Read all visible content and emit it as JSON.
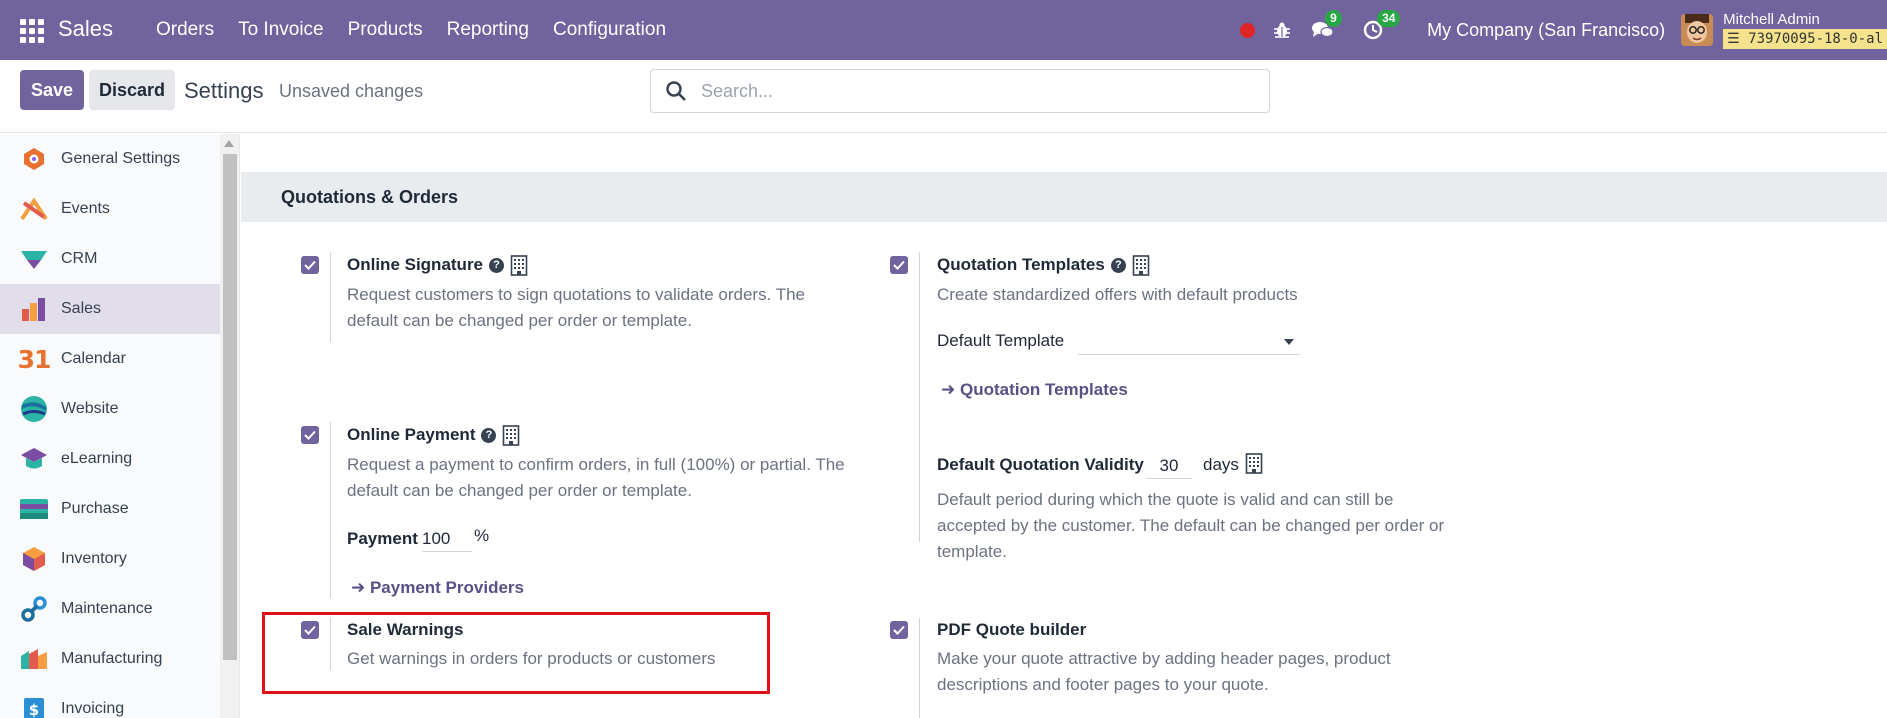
{
  "navbar": {
    "brand": "Sales",
    "menu": [
      "Orders",
      "To Invoice",
      "Products",
      "Reporting",
      "Configuration"
    ],
    "messages_count": "9",
    "activities_count": "34",
    "company": "My Company (San Francisco)",
    "user_name": "Mitchell Admin",
    "db_name": "73970095-18-0-al",
    "accent_color": "#71639e"
  },
  "control": {
    "save_label": "Save",
    "discard_label": "Discard",
    "title": "Settings",
    "status": "Unsaved changes",
    "search_placeholder": "Search..."
  },
  "sidebar": {
    "items": [
      {
        "label": "General Settings",
        "icon": "general-settings-icon"
      },
      {
        "label": "Events",
        "icon": "events-icon"
      },
      {
        "label": "CRM",
        "icon": "crm-icon"
      },
      {
        "label": "Sales",
        "icon": "sales-icon"
      },
      {
        "label": "Calendar",
        "icon": "calendar-icon"
      },
      {
        "label": "Website",
        "icon": "website-icon"
      },
      {
        "label": "eLearning",
        "icon": "elearning-icon"
      },
      {
        "label": "Purchase",
        "icon": "purchase-icon"
      },
      {
        "label": "Inventory",
        "icon": "inventory-icon"
      },
      {
        "label": "Maintenance",
        "icon": "maintenance-icon"
      },
      {
        "label": "Manufacturing",
        "icon": "manufacturing-icon"
      },
      {
        "label": "Invoicing",
        "icon": "invoicing-icon"
      }
    ],
    "calendar_icon_text": "31"
  },
  "main": {
    "section_title": "Quotations & Orders",
    "online_signature": {
      "title": "Online Signature",
      "desc": "Request customers to sign quotations to validate orders. The default can be changed per order or template.",
      "checked": true
    },
    "quotation_templates": {
      "title": "Quotation Templates",
      "desc": "Create standardized offers with default products",
      "default_template_label": "Default Template",
      "default_template_value": "",
      "link": "Quotation Templates",
      "checked": true
    },
    "online_payment": {
      "title": "Online Payment",
      "desc": "Request a payment to confirm orders, in full (100%) or partial. The default can be changed per order or template.",
      "payment_label": "Payment",
      "payment_value": "100",
      "payment_unit": "%",
      "link": "Payment Providers",
      "checked": true
    },
    "quotation_validity": {
      "title": "Default Quotation Validity",
      "value": "30",
      "unit": "days",
      "desc": "Default period during which the quote is valid and can still be accepted by the customer. The default can be changed per order or template."
    },
    "sale_warnings": {
      "title": "Sale Warnings",
      "desc": "Get warnings in orders for products or customers",
      "checked": true
    },
    "pdf_quote_builder": {
      "title": "PDF Quote builder",
      "desc": "Make your quote attractive by adding header pages, product descriptions and footer pages to your quote.",
      "checked": true
    }
  }
}
